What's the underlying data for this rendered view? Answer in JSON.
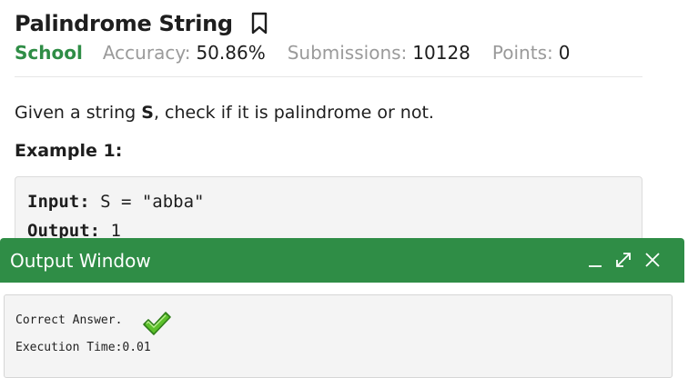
{
  "problem": {
    "title": "Palindrome String",
    "difficulty": "School",
    "accuracy_label": "Accuracy:",
    "accuracy_value": "50.86%",
    "submissions_label": "Submissions:",
    "submissions_value": "10128",
    "points_label": "Points:",
    "points_value": "0",
    "statement_prefix": "Given a string ",
    "statement_var": "S",
    "statement_suffix": ", check if it is palindrome or not.",
    "example_title": "Example 1:",
    "example": {
      "input_label": "Input:",
      "input_value": " S = \"abba\"",
      "output_label": "Output:",
      "output_value": " 1"
    }
  },
  "output_window": {
    "title": "Output Window",
    "result_text": "Correct Answer.",
    "execution_time": "Execution Time:0.01"
  },
  "icons": {
    "bookmark": "bookmark-icon",
    "minimize": "minimize-icon",
    "expand": "expand-icon",
    "close": "close-icon",
    "check": "checkmark-icon"
  },
  "colors": {
    "brand_green": "#2f8d46",
    "muted": "#9a9a9a",
    "code_bg": "#f4f4f4"
  }
}
